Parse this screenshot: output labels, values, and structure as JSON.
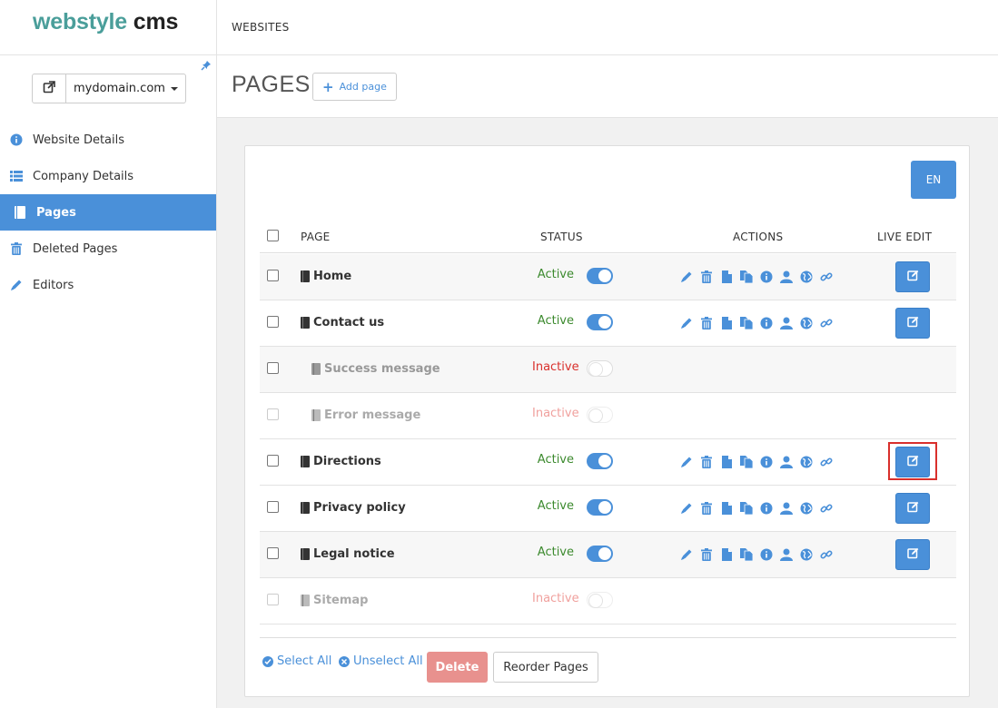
{
  "brand": {
    "part1": "webstyle",
    "part2": "cms"
  },
  "domain": {
    "selected": "mydomain.com"
  },
  "sidebar": {
    "items": [
      {
        "label": "Website Details",
        "icon": "info-circle-icon",
        "active": false
      },
      {
        "label": "Company Details",
        "icon": "list-icon",
        "active": false
      },
      {
        "label": "Pages",
        "icon": "page-icon",
        "active": true
      },
      {
        "label": "Deleted Pages",
        "icon": "trash-icon",
        "active": false
      },
      {
        "label": "Editors",
        "icon": "pencil-icon",
        "active": false
      }
    ]
  },
  "topbar": {
    "breadcrumb": "WEBSITES"
  },
  "header": {
    "title": "PAGES",
    "add_label": "Add page"
  },
  "language": "EN",
  "table": {
    "columns": {
      "page": "PAGE",
      "status": "STATUS",
      "actions": "ACTIONS",
      "live": "LIVE EDIT"
    },
    "rows": [
      {
        "name": "Home",
        "status": "Active",
        "enabled": true,
        "indent": false,
        "tone": "normal"
      },
      {
        "name": "Contact us",
        "status": "Active",
        "enabled": true,
        "indent": false,
        "tone": "normal"
      },
      {
        "name": "Success message",
        "status": "Inactive",
        "enabled": false,
        "indent": true,
        "tone": "inactive"
      },
      {
        "name": "Error message",
        "status": "Inactive",
        "enabled": false,
        "indent": true,
        "tone": "faded"
      },
      {
        "name": "Directions",
        "status": "Active",
        "enabled": true,
        "indent": false,
        "tone": "normal",
        "highlight": true
      },
      {
        "name": "Privacy policy",
        "status": "Active",
        "enabled": true,
        "indent": false,
        "tone": "normal"
      },
      {
        "name": "Legal notice",
        "status": "Active",
        "enabled": true,
        "indent": false,
        "tone": "normal"
      },
      {
        "name": "Sitemap",
        "status": "Inactive",
        "enabled": false,
        "indent": false,
        "tone": "faded"
      }
    ],
    "action_icons": [
      "pencil-icon",
      "trash-icon",
      "file-icon",
      "copy-icon",
      "info-icon",
      "user-icon",
      "globe-icon",
      "link-icon"
    ]
  },
  "footer": {
    "select_all": "Select All",
    "unselect_all": "Unselect All",
    "delete": "Delete",
    "reorder": "Reorder Pages"
  },
  "colors": {
    "accent": "#4a90d9",
    "brand_teal": "#4a9e9a",
    "active_green": "#3c8a2e",
    "inactive_red": "#d9302c"
  }
}
